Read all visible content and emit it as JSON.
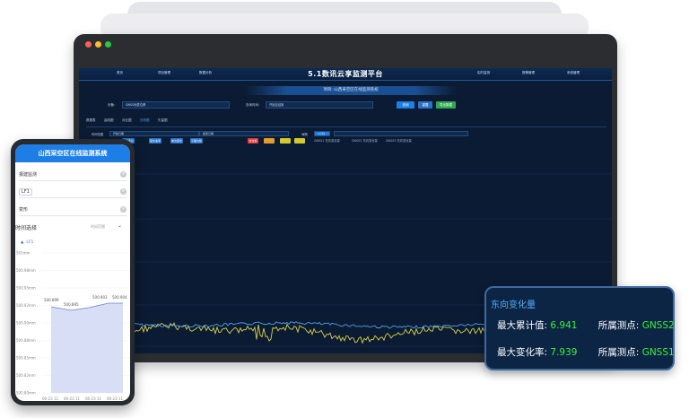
{
  "colors": {
    "accent": "#1d7fe6",
    "screen_bg": "#0b1b33",
    "series_blue": "#4aa3e6",
    "series_yellow": "#d8d24a",
    "value_green": "#3df03d",
    "card_title": "#52b0ff"
  },
  "laptop": {
    "window_dots": [
      "#ff5f57",
      "#febc2e",
      "#28c840"
    ],
    "app_title": "5.1数讯云享监测平台",
    "nav_left": [
      "首页",
      "项目管理",
      "数据分析"
    ],
    "nav_right": [
      "实时监测",
      "报警管理",
      "系统管理"
    ],
    "project_label": "项目: 山西采空区在线监测系统",
    "filters": {
      "device_label": "设备:",
      "device_value": "GNSS地表位移",
      "time_label": "查询时间:",
      "time_value": "开始至结束",
      "query_button": "查询",
      "reset_button": "重置",
      "export_button": "导出数据"
    },
    "tabs": [
      "数据表",
      "曲线图",
      "对比图",
      "分析图",
      "矢量图"
    ],
    "controls": {
      "range_label": "时间范围",
      "start_value": "开始日期",
      "end_value": "结束日期",
      "interval_label": "间隔",
      "interval_value": "1小时",
      "chip_labels": [
        "累计变化",
        "变化速率",
        "单次变化",
        "平面位移",
        "合位移"
      ],
      "legend": [
        "GNSS1 东向变化量",
        "GNSS2 东向变化量",
        "GNSS3 东向变化量"
      ]
    }
  },
  "phone": {
    "title": "山西采空区在线监测系统",
    "fields": [
      "报建监测",
      "LF1",
      "变形"
    ],
    "section_label": "时间选择",
    "section_right": "时间范围",
    "legend_name": "LF1",
    "y_ticks": [
      "501mm",
      "500.98mm",
      "500.95mm",
      "500.92mm",
      "500.90mm",
      "500.88mm",
      "500.85mm",
      "500.82mm",
      "500.80mm"
    ],
    "value_labels": [
      "500.899",
      "500.895",
      "500.903",
      "500.904"
    ],
    "x_ticks": [
      "06-23 11",
      "06-23 11",
      "06-23 11",
      "06-23 11"
    ]
  },
  "card": {
    "title": "东向变化量",
    "rows": [
      {
        "label": "最大累计值:",
        "value": "6.941",
        "point_label": "所属测点:",
        "point_value": "GNSS2"
      },
      {
        "label": "最大变化率:",
        "value": "7.939",
        "point_label": "所属测点:",
        "point_value": "GNSS1"
      }
    ]
  }
}
